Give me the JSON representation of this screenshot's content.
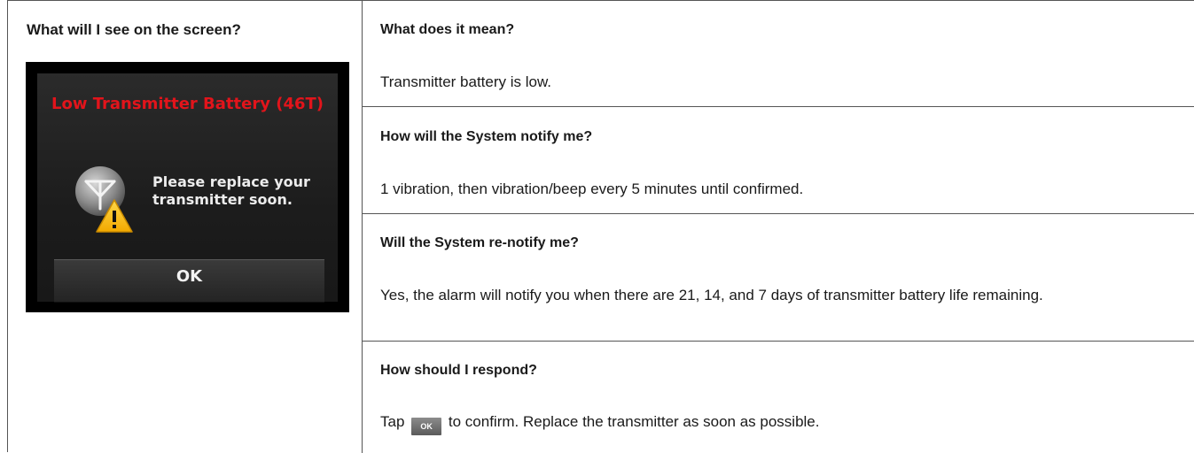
{
  "left": {
    "title": "What will I see on the screen?",
    "device": {
      "alert_title": "Low Transmitter Battery (46T)",
      "message_line1": "Please replace your",
      "message_line2": "transmitter soon.",
      "ok_label": "OK",
      "icons": [
        "transmitter-icon",
        "warning-icon"
      ],
      "title_color": "#e2141b"
    }
  },
  "rows": [
    {
      "question": "What does it mean?",
      "answer": "Transmitter battery is low."
    },
    {
      "question": "How will the System notify me?",
      "answer": "1 vibration, then vibration/beep every 5 minutes until confirmed."
    },
    {
      "question": "Will the System re-notify me?",
      "answer": "Yes, the alarm will notify you when there are 21, 14, and 7 days of transmitter battery life remaining."
    },
    {
      "question": "How should I respond?",
      "answer_prefix": "Tap",
      "ok_chip": "OK",
      "answer_suffix": "to confirm. Replace the transmitter as soon as possible."
    }
  ]
}
